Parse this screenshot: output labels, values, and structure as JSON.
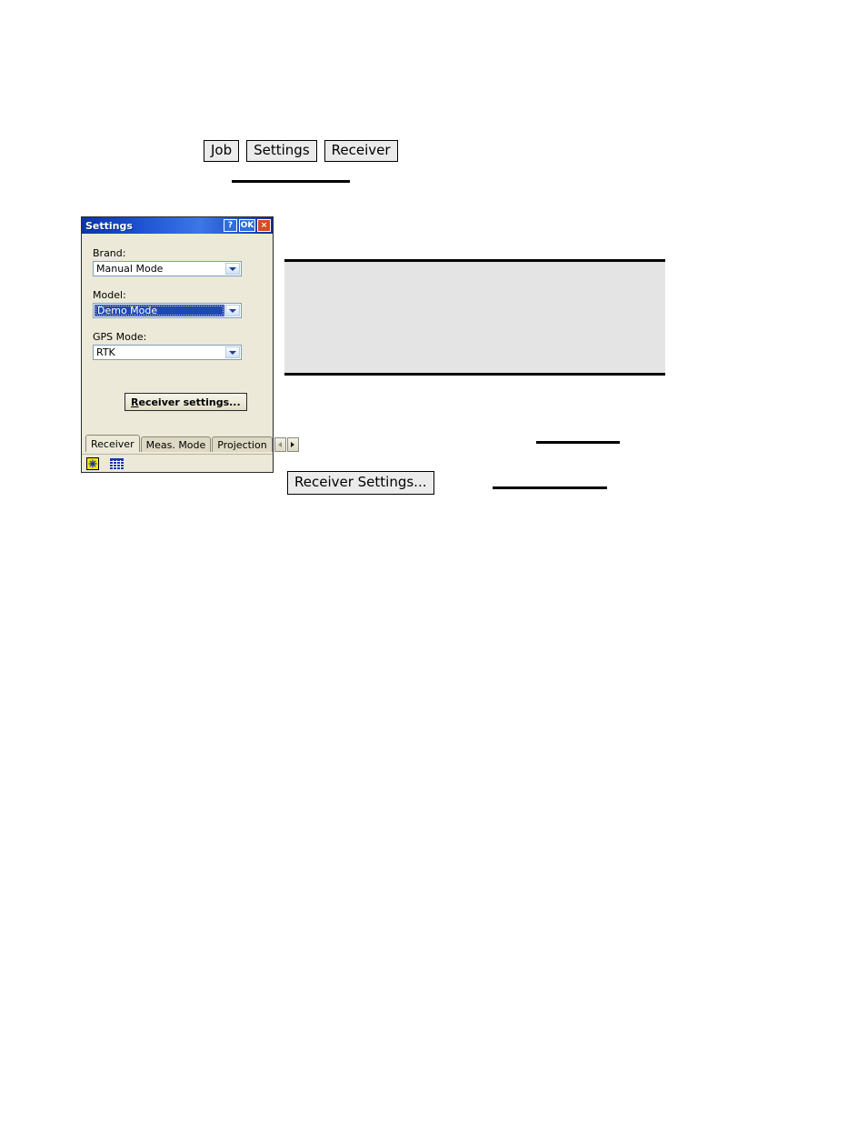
{
  "doc": {
    "nav_buttons": [
      {
        "label": "Job"
      },
      {
        "label": "Settings"
      },
      {
        "label": "Receiver"
      }
    ],
    "note_block_text": "",
    "inline_button_label": "Receiver Settings..."
  },
  "dialog": {
    "title": "Settings",
    "title_buttons": {
      "help": "?",
      "ok": "OK",
      "close": "×"
    },
    "fields": [
      {
        "label": "Brand:",
        "value": "Manual Mode",
        "selected": false
      },
      {
        "label": "Model:",
        "value": "Demo Mode",
        "selected": true
      },
      {
        "label": "GPS Mode:",
        "value": "RTK",
        "selected": false
      }
    ],
    "primary_button": {
      "accel": "R",
      "rest": "eceiver settings..."
    },
    "tabs": [
      {
        "label": "Receiver",
        "active": true
      },
      {
        "label": "Meas. Mode",
        "active": false
      },
      {
        "label": "Projection",
        "active": false
      }
    ],
    "tab_scroll": {
      "prev": "◄",
      "next": "►"
    },
    "status_icons": [
      {
        "name": "brightness-icon"
      },
      {
        "name": "keyboard-icon"
      }
    ]
  },
  "colors": {
    "titlebar_blue": "#1b4fd0",
    "close_red": "#d94a20",
    "dialog_face": "#ece9d8",
    "selection_blue": "#1b48b5",
    "note_grey": "#e4e4e4"
  }
}
